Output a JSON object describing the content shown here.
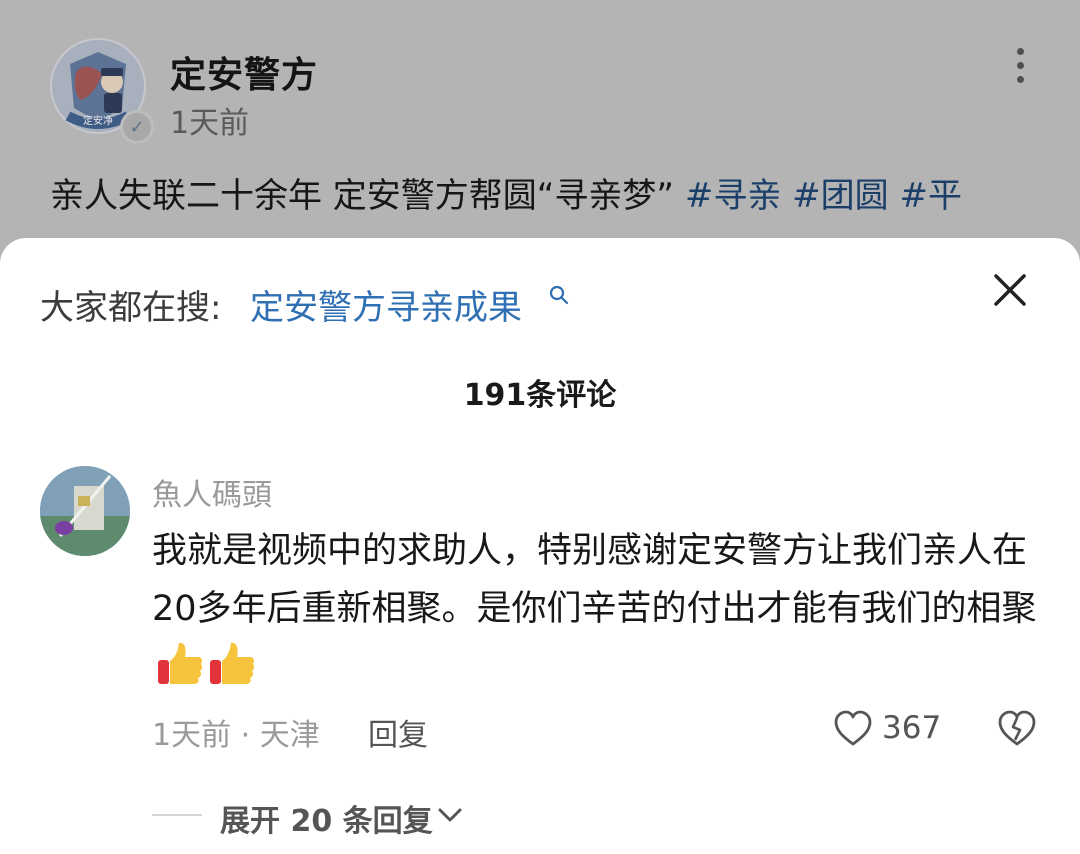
{
  "post": {
    "author": "定安警方",
    "time": "1天前",
    "text": "亲人失联二十余年 定安警方帮圆“寻亲梦”",
    "tags": [
      "#寻亲",
      "#团圆",
      "#平"
    ],
    "avatar_badge": "定安净",
    "verified_icon": "verified-v-icon"
  },
  "sheet": {
    "search_label": "大家都在搜:",
    "search_link": "定安警方寻亲成果",
    "comment_count": "191条评论",
    "comment": {
      "author": "魚人碼頭",
      "body": "我就是视频中的求助人，特别感谢定安警方让我们亲人在20多年后重新相聚。是你们辛苦的付出才能有我们的相聚",
      "time_location": "1天前 · 天津",
      "reply_label": "回复",
      "likes": "367",
      "emojis": [
        "thumbs-up",
        "thumbs-up"
      ]
    },
    "expand_label": "展开 20 条回复"
  },
  "colors": {
    "link": "#2f6fb4",
    "dim_overlay": "#b4b4b4",
    "sheet_bg": "#ffffff"
  }
}
